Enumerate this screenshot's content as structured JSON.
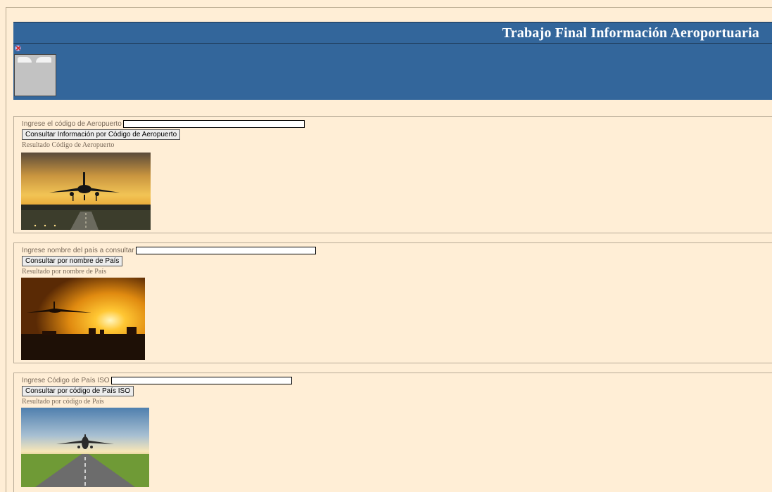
{
  "header": {
    "title": "Trabajo Final Información Aeroportuaria"
  },
  "sections": [
    {
      "input_label": "Ingrese el código de Aeropuerto",
      "input_value": "",
      "button_label": "Consultar Información por Código de Aeropuerto",
      "result_label": "Resultado Código de Aeropuerto"
    },
    {
      "input_label": "Ingrese nombre del país a consultar",
      "input_value": "",
      "button_label": "Consultar por nombre de País",
      "result_label": "Resultado por nombre de País"
    },
    {
      "input_label": "Ingrese Código de País ISO",
      "input_value": "",
      "button_label": "Consultar por código de País ISO",
      "result_label": "Resultado por código de País"
    }
  ],
  "colors": {
    "background": "#ffeed6",
    "header": "#33669b",
    "header_text": "#ffffff",
    "label_text": "#7a6a5a"
  }
}
